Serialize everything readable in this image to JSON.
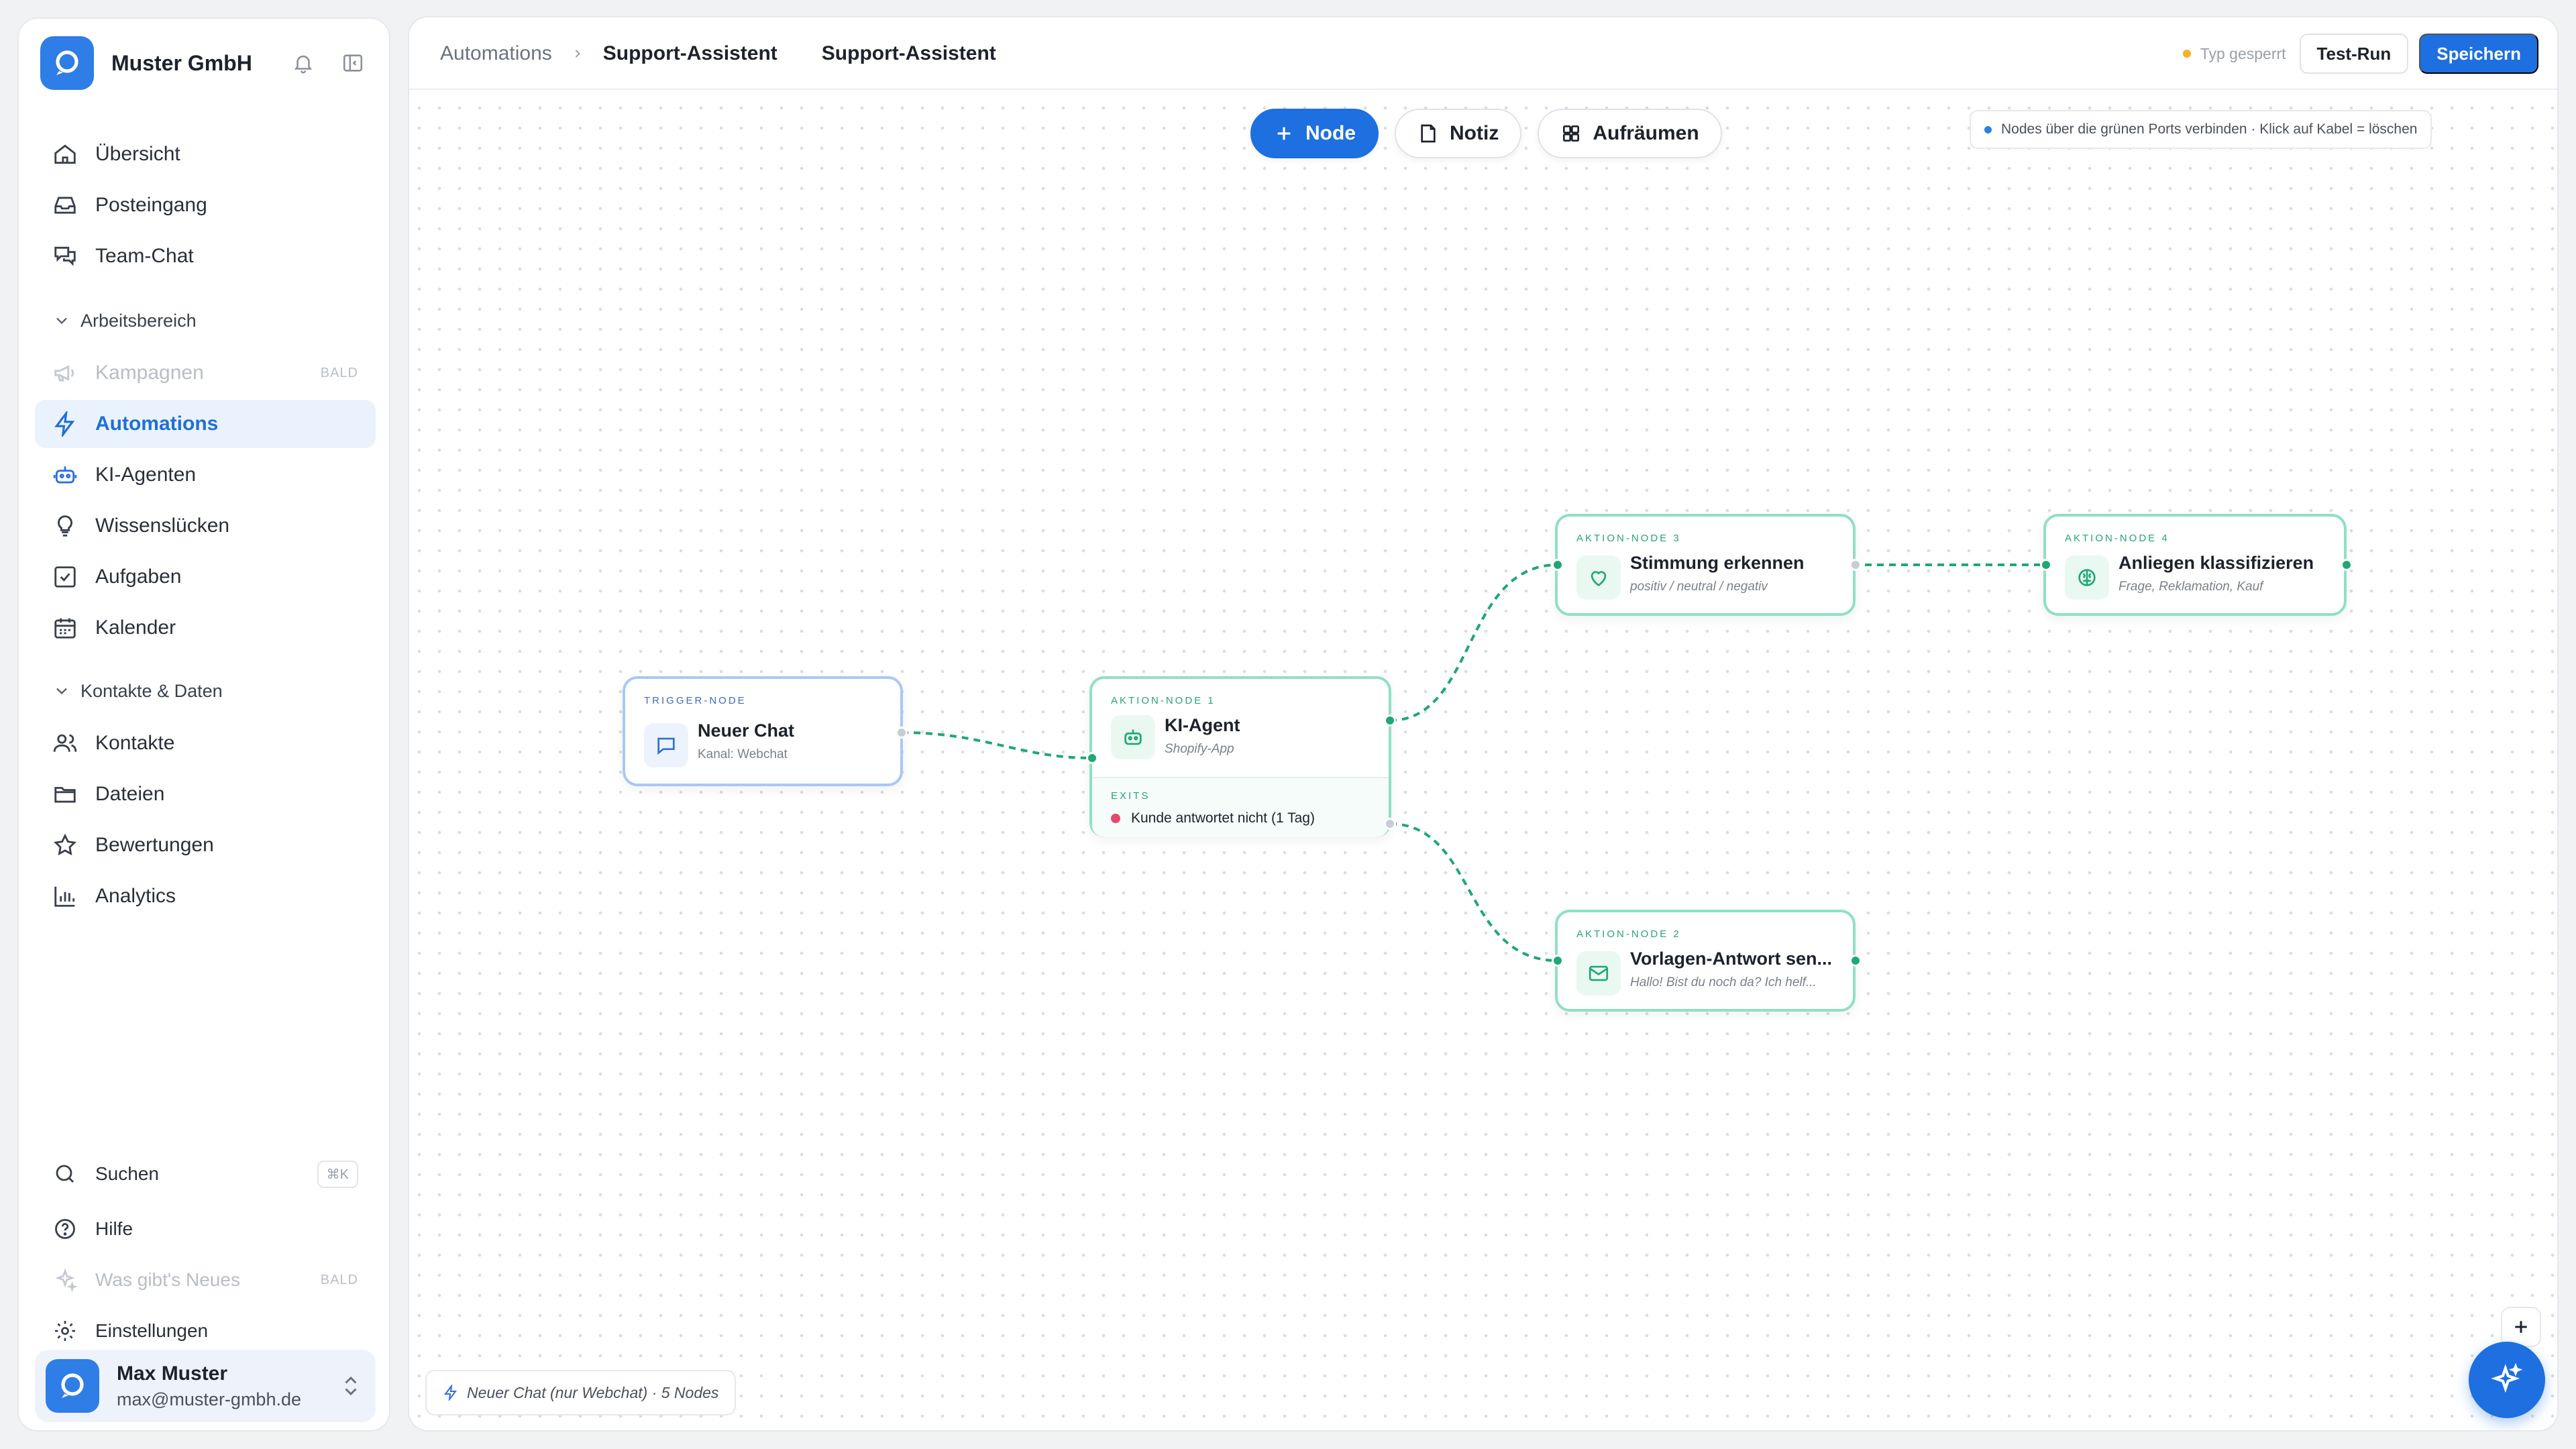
{
  "brand": {
    "name": "Muster GmbH"
  },
  "nav_primary": [
    {
      "label": "Übersicht"
    },
    {
      "label": "Posteingang"
    },
    {
      "label": "Team-Chat"
    }
  ],
  "sections": {
    "workspace": "Arbeitsbereich",
    "contacts": "Kontakte & Daten"
  },
  "nav_workspace": [
    {
      "label": "Kampagnen",
      "badge": "BALD",
      "disabled": true
    },
    {
      "label": "Automations",
      "active": true
    },
    {
      "label": "KI-Agenten"
    },
    {
      "label": "Wissenslücken"
    },
    {
      "label": "Aufgaben"
    },
    {
      "label": "Kalender"
    }
  ],
  "nav_contacts": [
    {
      "label": "Kontakte"
    },
    {
      "label": "Dateien"
    },
    {
      "label": "Bewertungen"
    },
    {
      "label": "Analytics"
    }
  ],
  "nav_bottom": {
    "search": {
      "label": "Suchen",
      "shortcut": "⌘K"
    },
    "help": {
      "label": "Hilfe"
    },
    "whats_new": {
      "label": "Was gibt's Neues",
      "badge": "BALD"
    },
    "settings": {
      "label": "Einstellungen"
    }
  },
  "user": {
    "name": "Max Muster",
    "email": "max@muster-gmbh.de"
  },
  "breadcrumb": {
    "root": "Automations",
    "current": "Support-Assistent",
    "title": "Support-Assistent"
  },
  "topbar": {
    "lock_status": "Typ gesperrt",
    "test_run": "Test-Run",
    "save": "Speichern"
  },
  "toolbar": {
    "node": "Node",
    "note": "Notiz",
    "cleanup": "Aufräumen"
  },
  "hint": "Nodes über die grünen Ports verbinden · Klick auf Kabel = löschen",
  "nodes": {
    "trigger": {
      "kicker": "TRIGGER-NODE",
      "title": "Neuer Chat",
      "subtitle": "Kanal: Webchat"
    },
    "action1": {
      "kicker": "AKTION-NODE 1",
      "title": "KI-Agent",
      "subtitle": "Shopify-App",
      "exits_label": "EXITS",
      "exit": "Kunde antwortet nicht (1 Tag)"
    },
    "action2": {
      "kicker": "AKTION-NODE 2",
      "title": "Vorlagen-Antwort sen...",
      "subtitle": "Hallo! Bist du noch da? Ich helf..."
    },
    "action3": {
      "kicker": "AKTION-NODE 3",
      "title": "Stimmung erkennen",
      "subtitle": "positiv / neutral / negativ"
    },
    "action4": {
      "kicker": "AKTION-NODE 4",
      "title": "Anliegen klassifizieren",
      "subtitle": "Frage, Reklamation, Kauf"
    }
  },
  "footer_summary": "Neuer Chat (nur Webchat) · 5 Nodes",
  "colors": {
    "accent": "#1e6fe0",
    "wire": "#1ea874",
    "node_border": "#8fe0c3",
    "trigger_border": "#a9c8f5",
    "exit_dot": "#e5486a",
    "lock_dot": "#f5b12b"
  }
}
